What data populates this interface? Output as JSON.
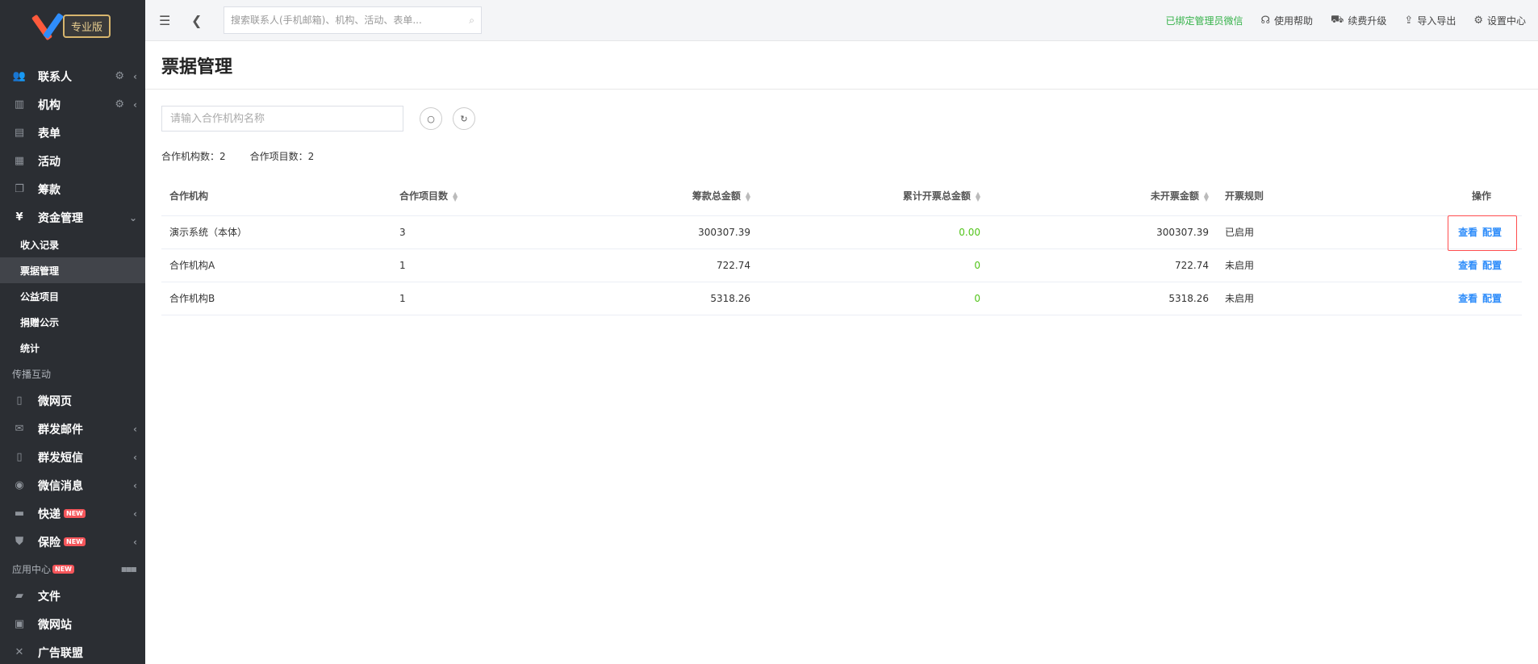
{
  "brand": {
    "badge": "专业版"
  },
  "sidebar": {
    "items": [
      {
        "id": "contacts",
        "label": "联系人",
        "icon": "users-icon",
        "gear": true,
        "chev": "‹"
      },
      {
        "id": "org",
        "label": "机构",
        "icon": "building-icon",
        "gear": true,
        "chev": "‹"
      },
      {
        "id": "forms",
        "label": "表单",
        "icon": "clipboard-icon"
      },
      {
        "id": "events",
        "label": "活动",
        "icon": "calendar-icon"
      },
      {
        "id": "fundraise",
        "label": "筹款",
        "icon": "cards-icon"
      },
      {
        "id": "finance",
        "label": "资金管理",
        "icon": "yen-icon",
        "chev": "⌄"
      }
    ],
    "finance_sub": [
      "收入记录",
      "票据管理",
      "公益项目",
      "捐赠公示",
      "统计"
    ],
    "section_spread": "传播互动",
    "spread_items": [
      {
        "label": "微网页",
        "icon": "doc-icon"
      },
      {
        "label": "群发邮件",
        "icon": "mail-icon",
        "chev": "‹"
      },
      {
        "label": "群发短信",
        "icon": "phone-icon",
        "chev": "‹"
      },
      {
        "label": "微信消息",
        "icon": "wechat-icon",
        "chev": "‹"
      },
      {
        "label": "快递",
        "icon": "truck-icon",
        "chev": "‹",
        "new": "NEW"
      },
      {
        "label": "保险",
        "icon": "shield-icon",
        "chev": "‹",
        "new": "NEW"
      }
    ],
    "section_apps": "应用中心",
    "apps_new": "NEW",
    "app_items": [
      {
        "label": "文件",
        "icon": "folder-icon"
      },
      {
        "label": "微网站",
        "icon": "site-icon"
      },
      {
        "label": "广告联盟",
        "icon": "ad-icon"
      }
    ]
  },
  "topbar": {
    "search_placeholder": "搜索联系人(手机邮箱)、机构、活动、表单...",
    "wechat_bound": "已绑定管理员微信",
    "help": "使用帮助",
    "upgrade": "续费升级",
    "import_export": "导入导出",
    "settings": "设置中心"
  },
  "page": {
    "title": "票据管理",
    "filter_placeholder": "请输入合作机构名称",
    "stat_org_label": "合作机构数：",
    "stat_org_value": "2",
    "stat_proj_label": "合作项目数：",
    "stat_proj_value": "2"
  },
  "table": {
    "headers": [
      "合作机构",
      "合作项目数",
      "筹款总金额",
      "累计开票总金额",
      "未开票金额",
      "开票规则",
      "操作"
    ],
    "rows": [
      {
        "org": "演示系统（本体）",
        "projects": "3",
        "raised": "300307.39",
        "invoiced": "0.00",
        "uninvoiced": "300307.39",
        "rule": "已启用"
      },
      {
        "org": "合作机构A",
        "projects": "1",
        "raised": "722.74",
        "invoiced": "0",
        "uninvoiced": "722.74",
        "rule": "未启用"
      },
      {
        "org": "合作机构B",
        "projects": "1",
        "raised": "5318.26",
        "invoiced": "0",
        "uninvoiced": "5318.26",
        "rule": "未启用"
      }
    ],
    "op_view": "查看",
    "op_config": "配置"
  }
}
